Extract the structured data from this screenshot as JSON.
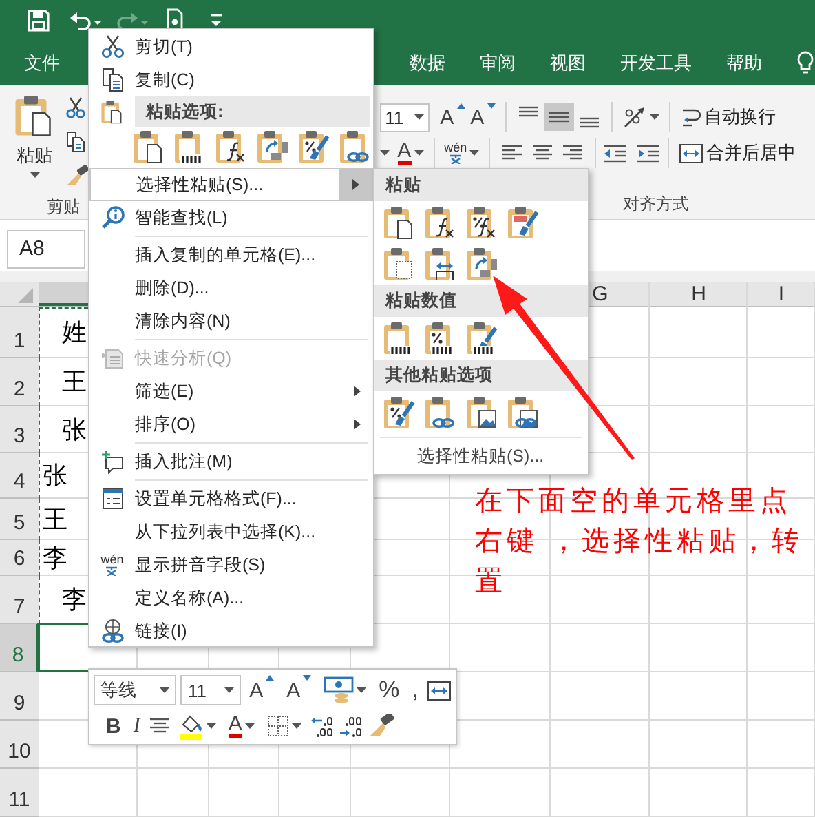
{
  "title_bar": {
    "quick_access": [
      {
        "kind": "save",
        "disabled": false
      },
      {
        "kind": "undo",
        "disabled": false
      },
      {
        "kind": "redo",
        "disabled": true
      },
      {
        "kind": "touch",
        "disabled": false
      },
      {
        "kind": "customize",
        "disabled": false
      }
    ]
  },
  "ribbon_tabs": [
    {
      "label": "文件",
      "selected": false
    },
    {
      "label": "数据",
      "selected": false
    },
    {
      "label": "审阅",
      "selected": false
    },
    {
      "label": "视图",
      "selected": false
    },
    {
      "label": "开发工具",
      "selected": false
    },
    {
      "label": "帮助",
      "selected": false
    }
  ],
  "ribbon": {
    "clipboard": {
      "paste_label": "粘贴",
      "group_label": "剪贴"
    },
    "font": {
      "size": "11",
      "grow": "A",
      "shrink": "A",
      "font_color": "A",
      "phonetic": "wén"
    },
    "alignment": {
      "vertical": [
        {
          "kind": "top",
          "selected": false
        },
        {
          "kind": "middle",
          "selected": true
        },
        {
          "kind": "bottom",
          "selected": false
        }
      ],
      "wrap_text": "自动换行",
      "merge_center": "合并后居中",
      "group_label": "对齐方式"
    }
  },
  "name_box": {
    "value": "A8"
  },
  "sheet": {
    "columns": [
      {
        "selected": true
      },
      {
        "label": "G",
        "selected": false
      },
      {
        "label": "H",
        "selected": false
      },
      {
        "label": "I",
        "selected": false
      }
    ],
    "rows": [
      {
        "header": "1",
        "cell": "姓",
        "kind": "centered",
        "copied": true,
        "selected": false
      },
      {
        "header": "2",
        "cell": "王",
        "kind": "centered",
        "copied": true,
        "selected": false
      },
      {
        "header": "3",
        "cell": "张",
        "kind": "centered",
        "copied": true,
        "selected": false
      },
      {
        "header": "4",
        "cell": "张",
        "kind": "left",
        "copied": true,
        "selected": false
      },
      {
        "header": "5",
        "cell": "王",
        "kind": "left",
        "copied": true,
        "selected": false
      },
      {
        "header": "6",
        "cell": "李",
        "kind": "left",
        "copied": true,
        "selected": false
      },
      {
        "header": "7",
        "cell": "李",
        "kind": "centered",
        "copied": true,
        "selected": false
      },
      {
        "header": "8",
        "copied": false,
        "selected": true
      },
      {
        "header": "9",
        "copied": false,
        "selected": false
      },
      {
        "header": "10",
        "copied": false,
        "selected": false
      },
      {
        "header": "11",
        "copied": false,
        "selected": false
      }
    ]
  },
  "context_menu": {
    "items": [
      {
        "kind": "cut",
        "label": "剪切(T)",
        "selected": false,
        "disabled": false,
        "submenu": false
      },
      {
        "kind": "copy",
        "label": "复制(C)",
        "selected": false,
        "disabled": false,
        "submenu": false
      },
      {
        "kind": "paste-header",
        "label": "粘贴选项:"
      },
      {
        "kind": "paste-options",
        "options": [
          {
            "kind": "paste"
          },
          {
            "kind": "values"
          },
          {
            "kind": "formulas"
          },
          {
            "kind": "transpose"
          },
          {
            "kind": "formatting"
          },
          {
            "kind": "link"
          }
        ]
      },
      {
        "kind": "plain",
        "label": "选择性粘贴(S)...",
        "selected": true,
        "disabled": false,
        "submenu": true
      },
      {
        "kind": "lookup",
        "label": "智能查找(L)",
        "selected": false,
        "disabled": false,
        "submenu": false
      },
      {
        "kind": "plain",
        "label": "插入复制的单元格(E)...",
        "selected": false,
        "disabled": false,
        "submenu": false,
        "divider_above": true
      },
      {
        "kind": "plain",
        "label": "删除(D)...",
        "selected": false,
        "disabled": false,
        "submenu": false
      },
      {
        "kind": "plain",
        "label": "清除内容(N)",
        "selected": false,
        "disabled": false,
        "submenu": false
      },
      {
        "kind": "quick-analysis",
        "label": "快速分析(Q)",
        "selected": false,
        "disabled": true,
        "submenu": false,
        "divider_above": true
      },
      {
        "kind": "plain",
        "label": "筛选(E)",
        "selected": false,
        "disabled": false,
        "submenu": true
      },
      {
        "kind": "plain",
        "label": "排序(O)",
        "selected": false,
        "disabled": false,
        "submenu": true
      },
      {
        "kind": "comment",
        "label": "插入批注(M)",
        "selected": false,
        "disabled": false,
        "submenu": false,
        "divider_above": true
      },
      {
        "kind": "format-cells",
        "label": "设置单元格格式(F)...",
        "selected": false,
        "disabled": false,
        "submenu": false,
        "divider_above": true
      },
      {
        "kind": "plain",
        "label": "从下拉列表中选择(K)...",
        "selected": false,
        "disabled": false,
        "submenu": false
      },
      {
        "kind": "phonetic",
        "label": "显示拼音字段(S)",
        "icon_text": "wén",
        "selected": false,
        "disabled": false,
        "submenu": false
      },
      {
        "kind": "plain",
        "label": "定义名称(A)...",
        "selected": false,
        "disabled": false,
        "submenu": false
      },
      {
        "kind": "link",
        "label": "链接(I)",
        "selected": false,
        "disabled": false,
        "submenu": false
      }
    ]
  },
  "paste_submenu": {
    "sections": [
      {
        "title": "粘贴",
        "options": [
          {
            "kind": "paste"
          },
          {
            "kind": "formulas"
          },
          {
            "kind": "formulas-number"
          },
          {
            "kind": "source-format"
          },
          {
            "kind": "no-borders"
          },
          {
            "kind": "column-widths"
          },
          {
            "kind": "transpose"
          }
        ]
      },
      {
        "title": "粘贴数值",
        "options": [
          {
            "kind": "values"
          },
          {
            "kind": "values-number"
          },
          {
            "kind": "values-source"
          }
        ]
      },
      {
        "title": "其他粘贴选项",
        "options": [
          {
            "kind": "formatting"
          },
          {
            "kind": "link"
          },
          {
            "kind": "picture"
          },
          {
            "kind": "linked-picture"
          }
        ]
      }
    ],
    "footer": "选择性粘贴(S)..."
  },
  "mini_toolbar": {
    "font": "等线",
    "size": "11",
    "row1": [
      {
        "kind": "grow",
        "text": "A"
      },
      {
        "kind": "shrink",
        "text": "A"
      },
      {
        "kind": "accounting"
      },
      {
        "kind": "symbol",
        "text": "%"
      },
      {
        "kind": "symbol",
        "text": ","
      },
      {
        "kind": "merge"
      }
    ],
    "row2": [
      {
        "kind": "bold",
        "text": "B"
      },
      {
        "kind": "italic",
        "text": "I"
      },
      {
        "kind": "center"
      },
      {
        "kind": "fill"
      },
      {
        "kind": "font-color",
        "text": "A"
      },
      {
        "kind": "borders"
      },
      {
        "kind": "increase-decimal"
      },
      {
        "kind": "decrease-decimal"
      },
      {
        "kind": "format-painter"
      }
    ]
  },
  "annotation": {
    "text": "在下面空的单元格里点右键 ，选择性粘贴，转置"
  }
}
